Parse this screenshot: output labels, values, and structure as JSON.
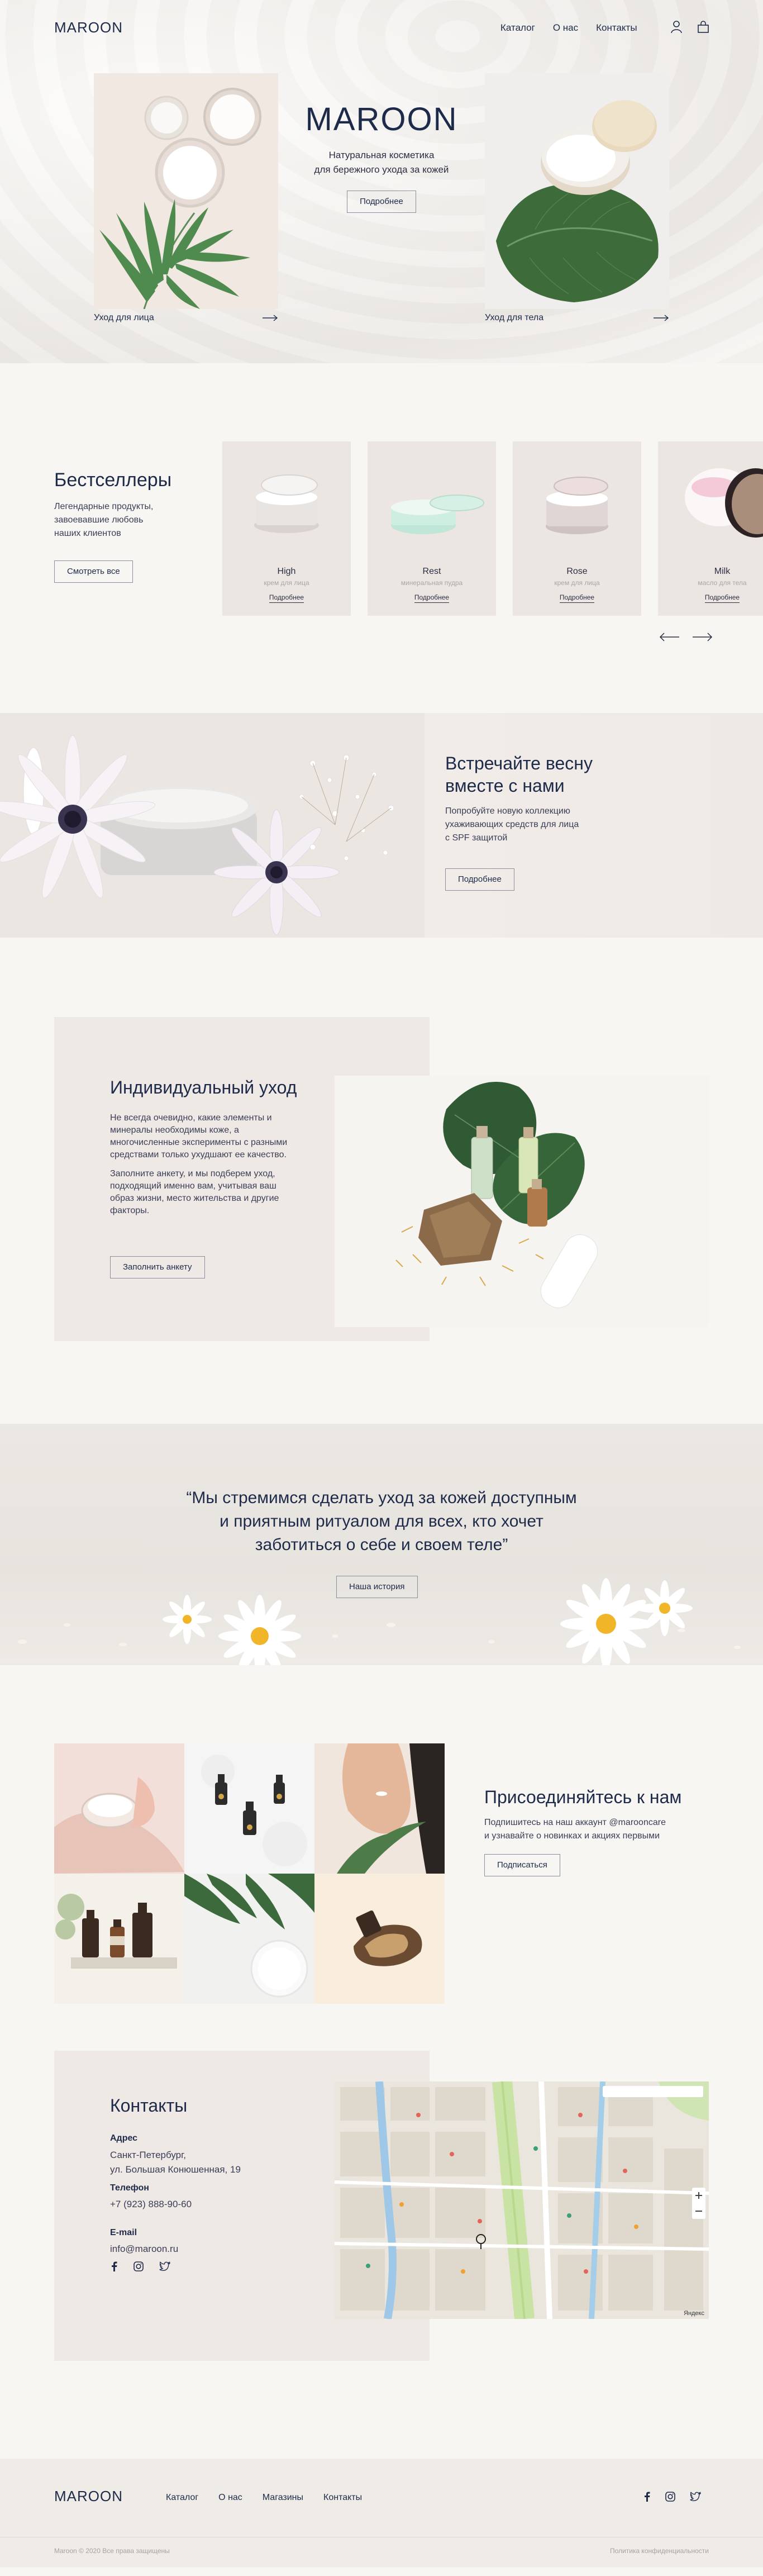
{
  "brand": {
    "logo": "MAROON"
  },
  "nav": {
    "items": [
      "Каталог",
      "О нас",
      "Контакты"
    ]
  },
  "hero": {
    "title": "MAROON",
    "subtitle_line1": "Натуральная косметика",
    "subtitle_line2": "для бережного ухода за кожей",
    "button": "Подробнее",
    "left_caption": "Уход для лица",
    "right_caption": "Уход для тела"
  },
  "bestsellers": {
    "title": "Бестселлеры",
    "desc_line1": "Легендарные продукты,",
    "desc_line2": "завоевавшие любовь",
    "desc_line3": "наших клиентов",
    "button": "Смотреть все",
    "products": [
      {
        "name": "High",
        "type": "крем для лица",
        "more": "Подробнее"
      },
      {
        "name": "Rest",
        "type": "минеральная пудра",
        "more": "Подробнее"
      },
      {
        "name": "Rose",
        "type": "крем для лица",
        "more": "Подробнее"
      },
      {
        "name": "Milk",
        "type": "масло для тела",
        "more": "Подробнее"
      }
    ]
  },
  "spring": {
    "title_line1": "Встречайте весну",
    "title_line2": "вместе с нами",
    "desc_line1": "Попробуйте новую коллекцию",
    "desc_line2": "ухаживающих средств для лица",
    "desc_line3": "с SPF защитой",
    "button": "Подробнее"
  },
  "individual": {
    "title": "Индивидуальный уход",
    "p1": "Не всегда очевидно, какие элементы и минералы необходимы коже, а многочисленные эксперименты с разными средствами только ухудшают ее качество.",
    "p2": "Заполните анкету, и мы подберем уход, подходящий именно вам, учитывая ваш образ жизни, место жительства и другие факторы.",
    "button": "Заполнить анкету"
  },
  "quote": {
    "line1": "“Мы стремимся сделать уход за кожей доступным",
    "line2": "и приятным ритуалом для всех, кто хочет",
    "line3": "заботиться о себе и своем теле”",
    "button": "Наша история"
  },
  "join": {
    "title": "Присоединяйтесь к нам",
    "desc_line1": "Подпишитесь на наш аккаунт @marooncare",
    "desc_line2": "и узнавайте о новинках и акциях первыми",
    "button": "Подписаться"
  },
  "contacts": {
    "title": "Контакты",
    "address_label": "Адрес",
    "address_line1": "Санкт-Петербург,",
    "address_line2": "ул. Большая Конюшенная, 19",
    "phone_label": "Телефон",
    "phone": "+7 (923) 888-90-60",
    "email_label": "E-mail",
    "email": "info@maroon.ru",
    "map_credit": "Яндекс"
  },
  "footer": {
    "logo": "MAROON",
    "nav": [
      "Каталог",
      "О нас",
      "Магазины",
      "Контакты"
    ],
    "copyright": "Maroon © 2020 Все права защищены",
    "policy": "Политика конфиденциальности"
  },
  "colors": {
    "navy": "#1e2a4a",
    "panel": "#efe9e5",
    "background": "#f8f6f3"
  }
}
